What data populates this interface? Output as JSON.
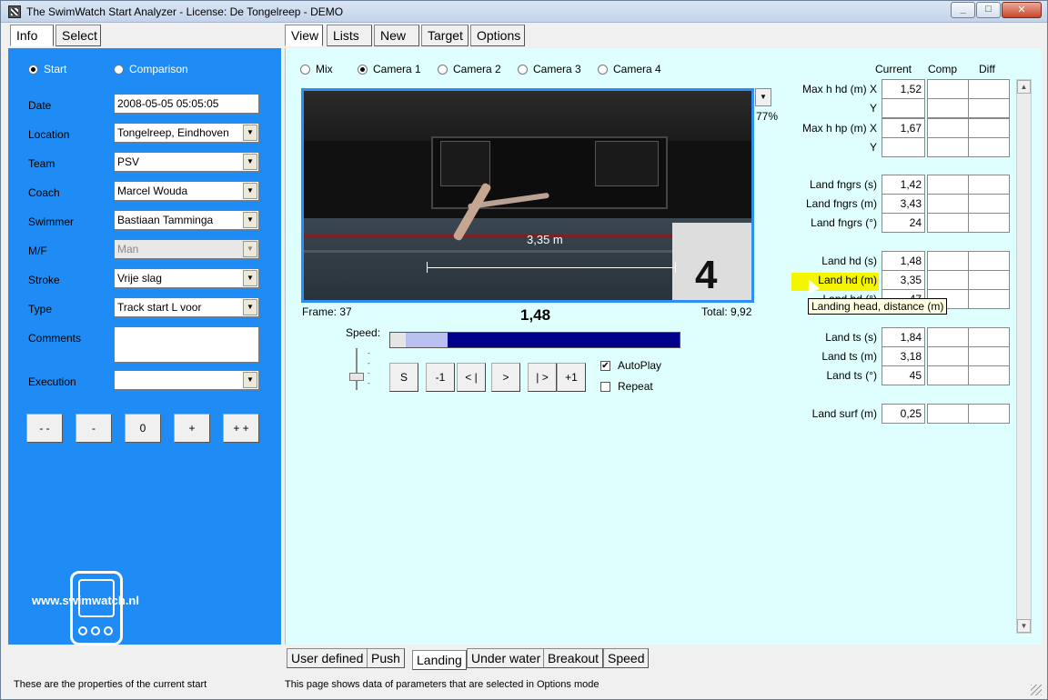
{
  "window": {
    "title": "The SwimWatch Start Analyzer - License: De Tongelreep - DEMO",
    "controls": {
      "minimize": "_",
      "maximize": "□",
      "close": "✕"
    }
  },
  "left_tabs": [
    "Info",
    "Select"
  ],
  "left_panel": {
    "mode_start": "Start",
    "mode_comparison": "Comparison",
    "fields": {
      "date": {
        "label": "Date",
        "value": "2008-05-05 05:05:05"
      },
      "location": {
        "label": "Location",
        "value": "Tongelreep, Eindhoven"
      },
      "team": {
        "label": "Team",
        "value": "PSV"
      },
      "coach": {
        "label": "Coach",
        "value": "Marcel Wouda"
      },
      "swimmer": {
        "label": "Swimmer",
        "value": "Bastiaan Tamminga"
      },
      "mf": {
        "label": "M/F",
        "value": "Man"
      },
      "stroke": {
        "label": "Stroke",
        "value": "Vrije slag"
      },
      "type": {
        "label": "Type",
        "value": "Track start L voor"
      },
      "comments": {
        "label": "Comments",
        "value": ""
      },
      "execution": {
        "label": "Execution",
        "value": ""
      }
    },
    "step_buttons": [
      "- -",
      "-",
      "0",
      "+",
      "+ +"
    ],
    "logo_url": "www.swimwatch.nl"
  },
  "main_tabs": [
    "View",
    "Lists",
    "New",
    "Target",
    "Options"
  ],
  "cameras": [
    "Mix",
    "Camera 1",
    "Camera 2",
    "Camera 3",
    "Camera 4"
  ],
  "video": {
    "measure_label": "3,35 m",
    "lane_number": "4",
    "zoom": "77%",
    "frame": "Frame: 37",
    "time": "1,48",
    "total": "Total: 9,92"
  },
  "playback": {
    "speed_label": "Speed:",
    "progress_fraction": 0.149,
    "buffer_fraction": 0.155,
    "buttons": [
      "S",
      "-1",
      "< |",
      ">",
      "| >",
      "+1"
    ],
    "autoplay": {
      "label": "AutoPlay",
      "checked": true
    },
    "repeat": {
      "label": "Repeat",
      "checked": false
    }
  },
  "param_table": {
    "headers": [
      "Current",
      "Comp",
      "Diff"
    ],
    "rows": [
      {
        "label": "Max h hd (m) X",
        "current": "1,52"
      },
      {
        "label": "Y",
        "current": ""
      },
      {
        "label": "Max h hp (m) X",
        "current": "1,67"
      },
      {
        "label": "Y",
        "current": ""
      },
      {
        "label": "Land fngrs (s)",
        "current": "1,42"
      },
      {
        "label": "Land fngrs (m)",
        "current": "3,43"
      },
      {
        "label": "Land fngrs (°)",
        "current": "24"
      },
      {
        "label": "Land hd (s)",
        "current": "1,48"
      },
      {
        "label": "Land hd (m)",
        "current": "3,35"
      },
      {
        "label": "Land hd (°)",
        "current": "47"
      },
      {
        "label": "Land ts (s)",
        "current": "1,84"
      },
      {
        "label": "Land ts (m)",
        "current": "3,18"
      },
      {
        "label": "Land ts (°)",
        "current": "45"
      },
      {
        "label": "Land surf (m)",
        "current": "0,25"
      }
    ],
    "tooltip": "Landing head, distance (m)"
  },
  "bottom_tabs": [
    "User defined",
    "Push",
    "Landing",
    "Under water",
    "Breakout",
    "Speed"
  ],
  "status": {
    "left": "These are the properties of the current start",
    "right": "This page shows data of parameters that are selected in Options mode"
  }
}
